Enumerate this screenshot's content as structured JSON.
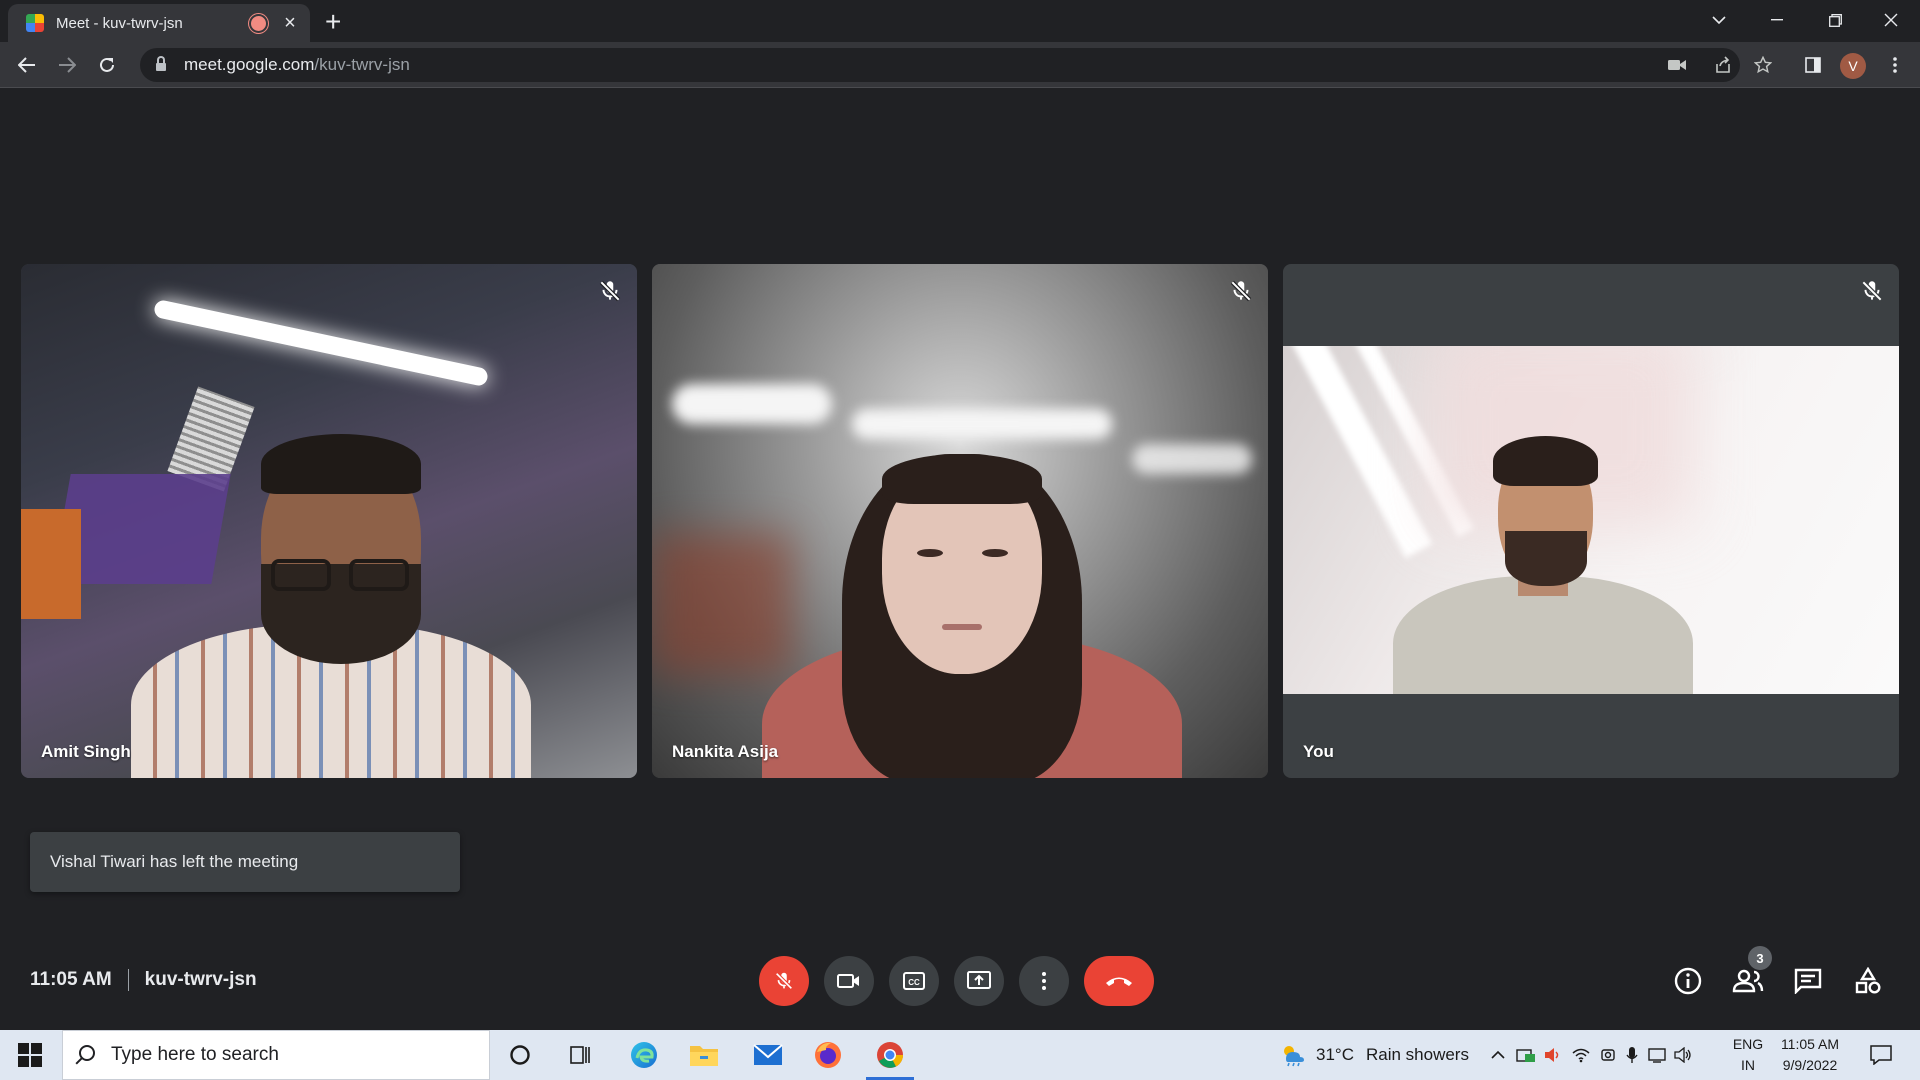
{
  "browser": {
    "tab_title": "Meet - kuv-twrv-jsn",
    "url_domain": "meet.google.com",
    "url_path": "/kuv-twrv-jsn",
    "profile_initial": "V"
  },
  "participants": [
    {
      "name": "Amit Singh",
      "muted": true
    },
    {
      "name": "Nankita Asija",
      "muted": true
    },
    {
      "name": "You",
      "muted": true
    }
  ],
  "toast": {
    "message": "Vishal Tiwari has left the meeting"
  },
  "meeting": {
    "time": "11:05 AM",
    "code": "kuv-twrv-jsn",
    "participant_count": "3"
  },
  "controls": [
    "mic-off",
    "camera",
    "captions",
    "present",
    "more",
    "leave-call"
  ],
  "taskbar": {
    "search_placeholder": "Type here to search",
    "weather_temp": "31°C",
    "weather_desc": "Rain showers",
    "lang_top": "ENG",
    "lang_bottom": "IN",
    "clock_time": "11:05 AM",
    "clock_date": "9/9/2022"
  },
  "colors": {
    "meet_bg": "#202124",
    "tile_bg": "#3c4043",
    "leave_red": "#ea4335",
    "taskbar_bg": "#dfe7f2"
  }
}
